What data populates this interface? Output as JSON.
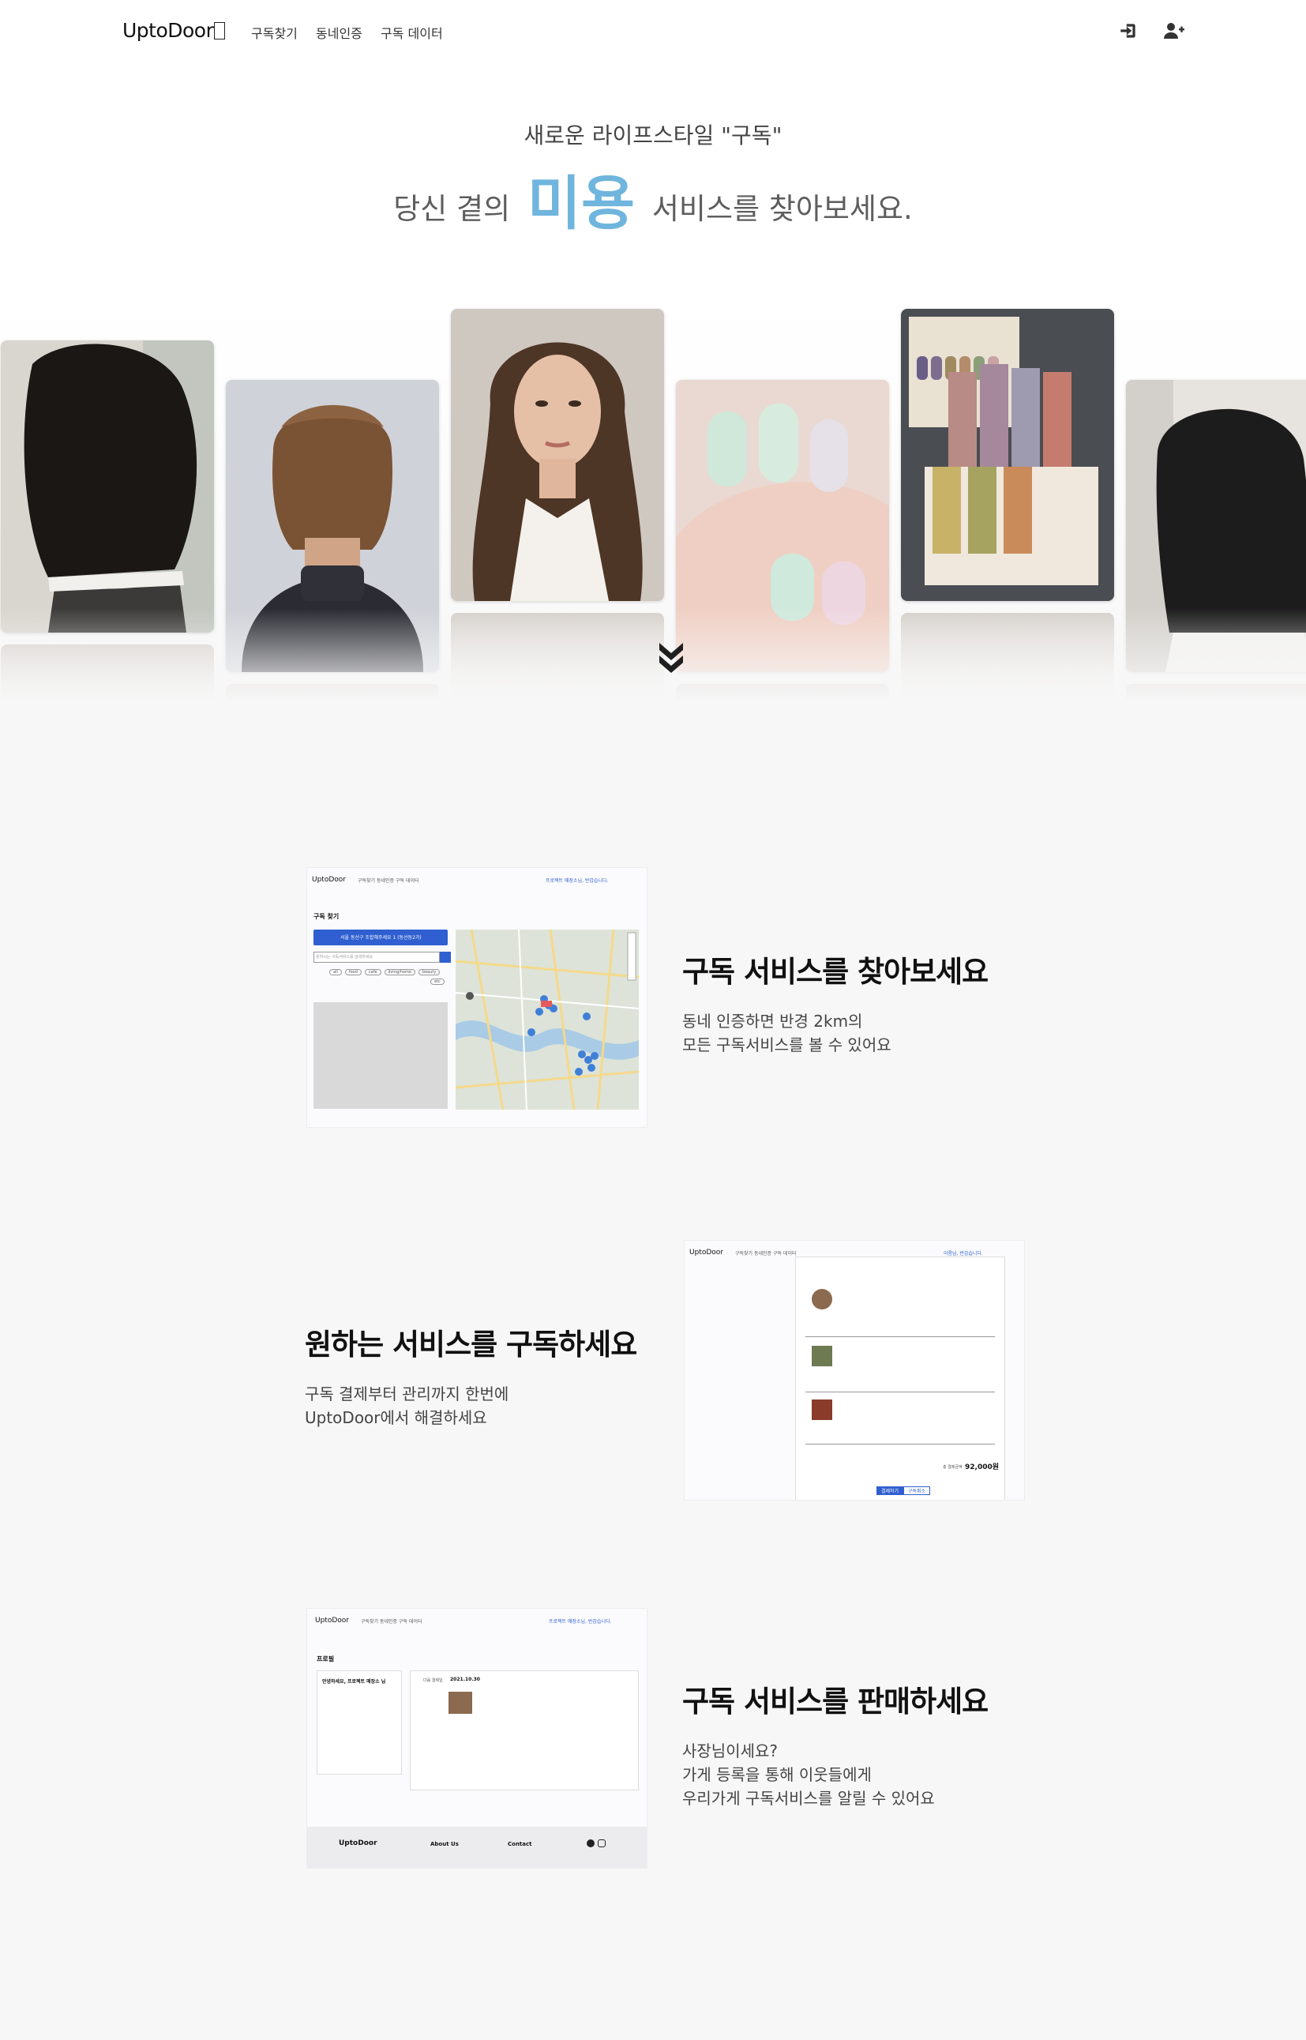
{
  "nav": {
    "brand": "UptoDoor",
    "links": [
      "구독찾기",
      "동네인증",
      "구독 데이터"
    ]
  },
  "hero": {
    "subtitle": "새로운 라이프스타일 \"구독\"",
    "title_before": "당신 곁의",
    "title_highlight": "미용",
    "title_after": "서비스를 찾아보세요."
  },
  "features": [
    {
      "title": "구독 서비스를 찾아보세요",
      "desc": [
        "동네 인증하면 반경 2km의",
        "모든 구독서비스를 볼 수 있어요"
      ]
    },
    {
      "title": "원하는 서비스를 구독하세요",
      "desc": [
        "구독 결제부터 관리까지 한번에",
        "UptoDoor에서 해결하세요"
      ]
    },
    {
      "title": "구독 서비스를 판매하세요",
      "desc": [
        "사장님이세요?",
        "가게 등록을 통해 이웃들에게",
        "우리가게 구독서비스를 알릴 수 있어요"
      ]
    }
  ],
  "shot1": {
    "brand": "UptoDoor",
    "nav": "구독찾기   동네인증   구독 데이터",
    "user": "프로젝트 매장소님, 반갑습니다.",
    "heading": "구독 찾기",
    "button": "서울 동선구 조합해주세요 1 (동선동2가)",
    "search_placeholder": "원하시는 구독서비스를 검색하세요",
    "tags": [
      "all",
      "food",
      "cafe",
      "living/home",
      "beauty",
      "etc"
    ]
  },
  "shot2": {
    "brand": "UptoDoor",
    "nav": "구독찾기   동네인증   구독 데이터",
    "user": "이름님, 반갑습니다.",
    "total_label": "총 결제금액",
    "total": "92,000원",
    "pay_button": "결제하기",
    "cancel_button": "구독취소"
  },
  "shot3": {
    "brand": "UptoDoor",
    "nav": "구독찾기   동네인증   구독 데이터",
    "user": "프로젝트 매장소님, 반갑습니다.",
    "heading": "프로필",
    "greeting": "안녕하세요, 프로젝트 매장소 님",
    "date_label": "다음 결제일",
    "date": "2021.10.30",
    "footer_brand": "UptoDoor",
    "footer_about": "About Us",
    "footer_contact": "Contact"
  },
  "colors": {
    "accent": "#6fb5dd",
    "primary_button": "#2f5fd0",
    "background": "#f7f7f7"
  },
  "icons": {
    "login": "sign-in-icon",
    "signup": "user-plus-icon",
    "scroll": "double-chevron-down-icon"
  }
}
